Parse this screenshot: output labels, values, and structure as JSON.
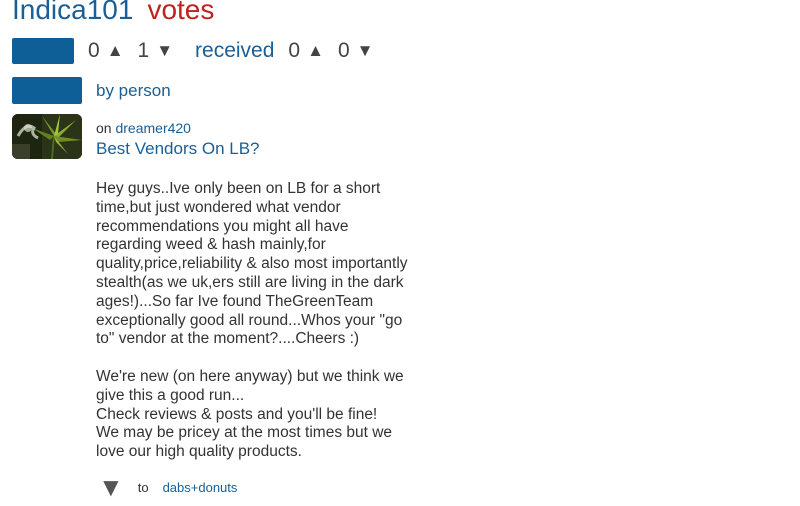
{
  "header": {
    "username": "Indica101",
    "votes_word": "votes"
  },
  "votes_given": {
    "up_count": "0",
    "up_icon": "▲",
    "down_count": "1",
    "down_icon": "▼",
    "received_label": "received",
    "received_up_count": "0",
    "received_down_count": "0"
  },
  "by_person": {
    "label": "by person"
  },
  "post": {
    "on_prefix": "on",
    "author": "dreamer420",
    "title": "Best Vendors On LB?",
    "body_lines": [
      "Hey guys..Ive only been on LB for a short",
      "time,but just wondered what vendor",
      "recommendations you might all have",
      "regarding weed & hash mainly,for",
      "quality,price,reliability & also most importantly",
      "stealth(as we uk,ers still are living in the dark",
      "ages!)...So far Ive found TheGreenTeam",
      "exceptionally good all round...Whos your \"go",
      "to\" vendor at the moment?....Cheers :)"
    ],
    "reply_lines": [
      "We're new (on here anyway) but we think we",
      "give this a good run...",
      "Check reviews & posts and you'll be fine!",
      "We may be pricey at the most times but we",
      "love our high quality products."
    ]
  },
  "vote": {
    "icon": "▼",
    "to_word": "to",
    "target": "dabs+donuts"
  },
  "colors": {
    "link_blue": "#1a5f95",
    "button_blue": "#0e5f97",
    "votes_red": "#c0201f"
  }
}
